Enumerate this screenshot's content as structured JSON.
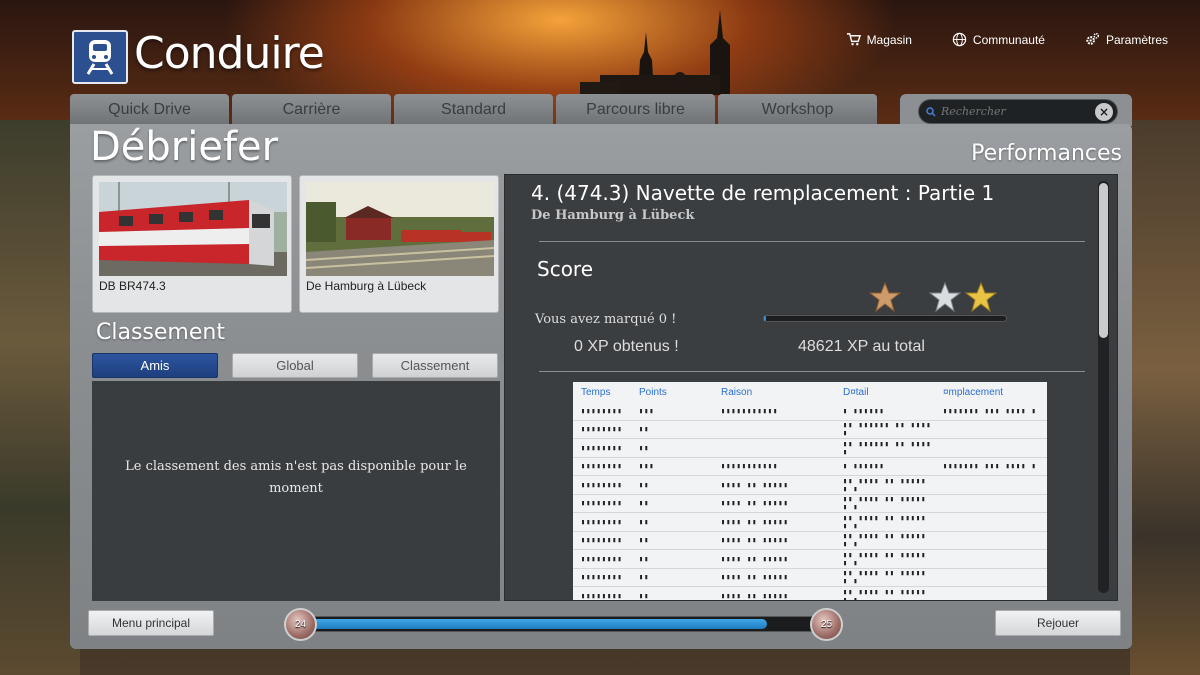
{
  "app": {
    "title": "Conduire"
  },
  "top_links": [
    {
      "label": "Magasin",
      "icon": "cart-icon"
    },
    {
      "label": "Communauté",
      "icon": "globe-icon"
    },
    {
      "label": "Paramètres",
      "icon": "gear-icon"
    }
  ],
  "tabs": [
    "Quick Drive",
    "Carrière",
    "Standard",
    "Parcours libre",
    "Workshop"
  ],
  "search": {
    "placeholder": "Rechercher"
  },
  "page": {
    "title": "Débriefer",
    "right_title": "Performances"
  },
  "cards": [
    {
      "caption": "DB BR474.3"
    },
    {
      "caption": "De Hamburg à Lübeck"
    }
  ],
  "leaderboard": {
    "title": "Classement",
    "segments": [
      "Amis",
      "Global",
      "Classement"
    ],
    "active_segment": "Amis",
    "message": "Le classement des amis n'est pas disponible pour le moment"
  },
  "performance": {
    "title": "4. (474.3) Navette de remplacement : Partie 1",
    "subtitle": "De Hamburg à Lübeck",
    "score_label": "Score",
    "scored_text": "Vous avez marqué 0 !",
    "xp_gained": "0 XP obtenus !",
    "xp_total": "48621 XP au total",
    "score_progress": 0.01,
    "table": {
      "headers": [
        "Temps",
        "Points",
        "Raison",
        "D¤tail",
        "¤mplacement"
      ],
      "rows": [
        [
          "▮▮▮▮▮▮▮▮",
          "▮▮▮",
          "▮▮▮▮▮▮▮▮▮▮▮",
          "▮ ▮▮▮▮▮▮",
          "▮▮▮▮▮▮▮ ▮▮▮ ▮▮▮▮ ▮"
        ],
        [
          "▮▮▮▮▮▮▮▮",
          "▮▮",
          "",
          "▮▮   ▮▮▮▮▮▮ ▮▮ ▮▮▮▮ ▮",
          ""
        ],
        [
          "▮▮▮▮▮▮▮▮",
          "▮▮",
          "",
          "▮▮   ▮▮▮▮▮▮ ▮▮ ▮▮▮▮ ▮",
          ""
        ],
        [
          "▮▮▮▮▮▮▮▮",
          "▮▮▮",
          "▮▮▮▮▮▮▮▮▮▮▮",
          "▮ ▮▮▮▮▮▮",
          "▮▮▮▮▮▮▮ ▮▮▮ ▮▮▮▮ ▮"
        ],
        [
          "▮▮▮▮▮▮▮▮",
          "▮▮",
          "▮▮▮▮ ▮▮ ▮▮▮▮▮",
          "▮▮ ▮▮▮▮ ▮▮ ▮▮▮▮▮ ▮ ▮",
          ""
        ],
        [
          "▮▮▮▮▮▮▮▮",
          "▮▮",
          "▮▮▮▮ ▮▮ ▮▮▮▮▮",
          "▮▮ ▮▮▮▮ ▮▮ ▮▮▮▮▮ ▮ ▮",
          ""
        ],
        [
          "▮▮▮▮▮▮▮▮",
          "▮▮",
          "▮▮▮▮ ▮▮ ▮▮▮▮▮",
          "▮▮ ▮▮▮▮ ▮▮ ▮▮▮▮▮ ▮ ▮",
          ""
        ],
        [
          "▮▮▮▮▮▮▮▮",
          "▮▮",
          "▮▮▮▮ ▮▮ ▮▮▮▮▮",
          "▮▮ ▮▮▮▮ ▮▮ ▮▮▮▮▮ ▮ ▮",
          ""
        ],
        [
          "▮▮▮▮▮▮▮▮",
          "▮▮",
          "▮▮▮▮ ▮▮ ▮▮▮▮▮",
          "▮▮ ▮▮▮▮ ▮▮ ▮▮▮▮▮ ▮ ▮",
          ""
        ],
        [
          "▮▮▮▮▮▮▮▮",
          "▮▮",
          "▮▮▮▮ ▮▮ ▮▮▮▮▮",
          "▮▮ ▮▮▮▮ ▮▮ ▮▮▮▮▮ ▮ ▮",
          ""
        ],
        [
          "▮▮▮▮▮▮▮▮",
          "▮▮",
          "▮▮▮▮ ▮▮ ▮▮▮▮▮",
          "▮▮ ▮▮▮▮ ▮▮ ▮▮▮▮▮ ▮ ▮",
          ""
        ]
      ]
    }
  },
  "bottom": {
    "menu_button": "Menu principal",
    "replay_button": "Rejouer",
    "level_current": "24",
    "level_next": "25",
    "level_progress": 0.88
  },
  "colors": {
    "accent_blue": "#1f7cc0",
    "active_tab_blue": "#2d56a0",
    "star_bronze": "#cd9b6a",
    "star_silver": "#d8dde2",
    "star_gold": "#e8c344"
  }
}
